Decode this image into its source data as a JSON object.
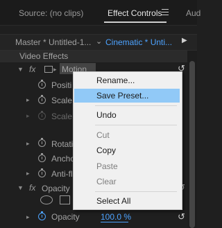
{
  "tabs": {
    "source": "Source: (no clips)",
    "effect_controls": "Effect Controls",
    "audio": "Aud"
  },
  "clip_row": {
    "master": "Master * Untitled-1...",
    "sequence": "Cinematic * Unti..."
  },
  "panel": {
    "section": "Video Effects",
    "fx": "fx",
    "motion": "Motion",
    "position": "Positi",
    "scale": "Scale",
    "scale_width": "Scale W",
    "rotation": "Rotati",
    "anchor": "Ancho",
    "anti_flicker": "Anti-fl",
    "opacity_group": "Opacity",
    "opacity_param": "Opacity",
    "opacity_value": "100.0 %"
  },
  "context_menu": {
    "items": [
      {
        "label": "Rename...",
        "enabled": true
      },
      {
        "label": "Save Preset...",
        "enabled": true,
        "highlighted": true
      },
      {
        "label": "Undo",
        "enabled": true
      },
      {
        "label": "Cut",
        "enabled": false
      },
      {
        "label": "Copy",
        "enabled": true
      },
      {
        "label": "Paste",
        "enabled": false
      },
      {
        "label": "Clear",
        "enabled": false
      },
      {
        "label": "Select All",
        "enabled": true
      }
    ]
  },
  "colors": {
    "accent_blue": "#4da3ff",
    "menu_highlight": "#91c9f7",
    "panel_bg": "#1f1f1f"
  }
}
